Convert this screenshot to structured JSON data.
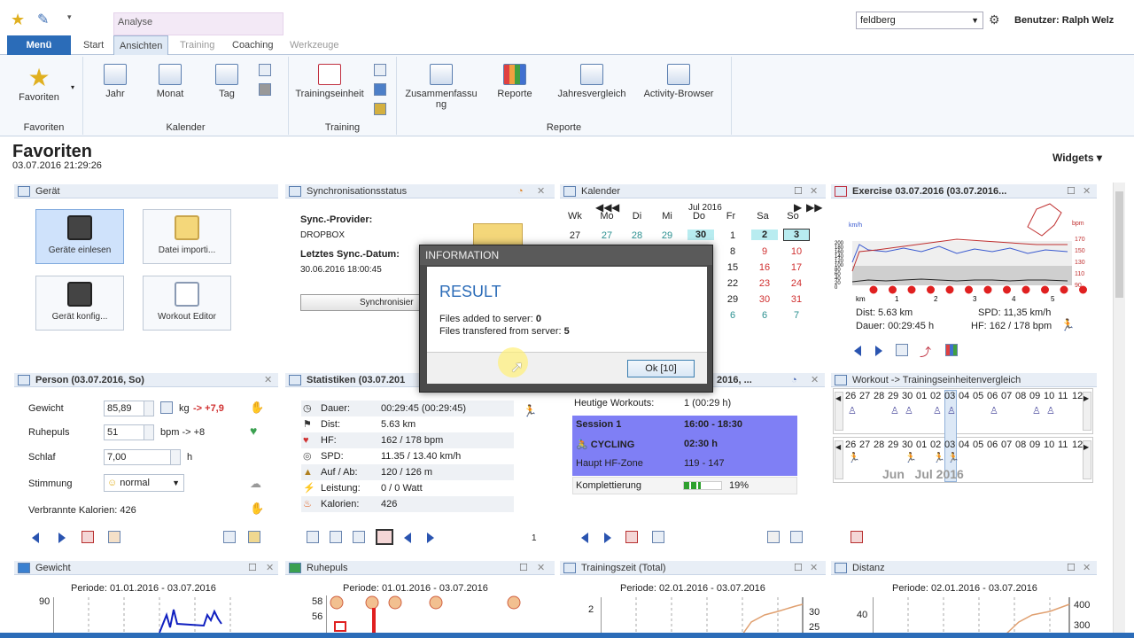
{
  "app": {
    "workspace": "feldberg",
    "user_label": "Benutzer: Ralph Welz",
    "context_tab": "Analyse"
  },
  "tabs": {
    "menu": "Menü",
    "start": "Start",
    "ansichten": "Ansichten",
    "training": "Training",
    "coaching": "Coaching",
    "werkzeuge": "Werkzeuge"
  },
  "ribbon": {
    "favoriten": "Favoriten",
    "jahr": "Jahr",
    "monat": "Monat",
    "tag": "Tag",
    "trainingseinheit": "Trainingseinheit",
    "zusammenfassung": "Zusammenfassu\nng",
    "reporte": "Reporte",
    "jahresvergleich": "Jahresvergleich",
    "activity_browser": "Activity-Browser",
    "group_favoriten": "Favoriten",
    "group_kalender": "Kalender",
    "group_training": "Training",
    "group_reporte": "Reporte"
  },
  "page": {
    "title": "Favoriten",
    "datetime": "03.07.2016 21:29:26",
    "widgets": "Widgets"
  },
  "geraet": {
    "title": "Gerät",
    "tile1": "Geräte einlesen",
    "tile2": "Datei importi...",
    "tile3": "Gerät konfig...",
    "tile4": "Workout Editor"
  },
  "sync": {
    "title": "Synchronisationsstatus",
    "provider_label": "Sync.-Provider:",
    "provider": "DROPBOX",
    "date_label": "Letztes Sync.-Datum:",
    "date": "30.06.2016 18:00:45",
    "button": "Synchronisier"
  },
  "kalender": {
    "title": "Kalender",
    "month": "Jul 2016",
    "days": [
      "Wk",
      "Mo",
      "Di",
      "Mi",
      "Do",
      "Fr",
      "Sa",
      "So"
    ],
    "row1": [
      "27",
      "27",
      "28",
      "29",
      "30",
      "1",
      "2",
      "3"
    ],
    "col_fr": [
      "8",
      "15",
      "22",
      "29",
      "6"
    ],
    "col_sa": [
      "9",
      "16",
      "23",
      "30"
    ],
    "col_so": [
      "10",
      "17",
      "24",
      "31",
      "7"
    ]
  },
  "exercise": {
    "title": "Exercise 03.07.2016 (03.07.2016...",
    "dist": "Dist: 5.63 km",
    "spd": "SPD: 11,35 km/h",
    "dauer": "Dauer: 00:29:45 h",
    "hf": "HF: 162 / 178 bpm",
    "unit_left": "km/h",
    "unit_right": "bpm",
    "y_left": [
      "200",
      "180",
      "160",
      "140",
      "120",
      "100",
      "80",
      "60",
      "40",
      "20",
      "0"
    ],
    "y_right": [
      "170",
      "150",
      "130",
      "110",
      "90"
    ],
    "x": [
      "km",
      "1",
      "2",
      "3",
      "4",
      "5"
    ]
  },
  "person": {
    "title": "Person (03.07.2016, So)",
    "gewicht_label": "Gewicht",
    "gewicht": "85,89",
    "gewicht_unit": "kg",
    "gewicht_delta": "-> +7,9",
    "ruhepuls_label": "Ruhepuls",
    "ruhepuls": "51",
    "ruhepuls_unit": "bpm -> +8",
    "schlaf_label": "Schlaf",
    "schlaf": "7,00",
    "schlaf_unit": "h",
    "stimmung_label": "Stimmung",
    "stimmung": "normal",
    "kalorien": "Verbrannte Kalorien: 426"
  },
  "statistiken": {
    "title": "Statistiken (03.07.201",
    "rows": [
      [
        "Dauer:",
        "00:29:45 (00:29:45)"
      ],
      [
        "Dist:",
        "5.63 km"
      ],
      [
        "HF:",
        "162 / 178 bpm"
      ],
      [
        "SPD:",
        "11.35 / 13.40 km/h"
      ],
      [
        "Auf / Ab:",
        "120 / 126 m"
      ],
      [
        "Leistung:",
        "0 / 0 Watt"
      ],
      [
        "Kalorien:",
        "426"
      ]
    ],
    "page": "1"
  },
  "workouts": {
    "title": "2016, ...",
    "heutige": "Heutige Workouts:",
    "heutige_val": "1 (00:29 h)",
    "session": "Session 1",
    "session_time": "16:00 - 18:30",
    "sport": "CYCLING",
    "sport_time": "02:30 h",
    "zone_label": "Haupt HF-Zone",
    "zone": "119 - 147",
    "kompl_label": "Komplettierung",
    "kompl": "19%",
    "kompl_pct": 0.19
  },
  "vergleich": {
    "title": "Workout -> Trainingseinheitenvergleich",
    "days": [
      "26",
      "27",
      "28",
      "29",
      "30",
      "01",
      "02",
      "03",
      "04",
      "05",
      "06",
      "07",
      "08",
      "09",
      "10",
      "11",
      "12"
    ],
    "months": "Jun   Jul 2016"
  },
  "bottom": {
    "gewicht": "Gewicht",
    "ruhepuls": "Ruhepuls",
    "trainingszeit": "Trainingszeit (Total)",
    "distanz": "Distanz",
    "periode1": "Periode: 01.01.2016 - 03.07.2016",
    "periode2": "Periode: 01.01.2016 - 03.07.2016",
    "periode3": "Periode: 02.01.2016 - 03.07.2016",
    "periode4": "Periode: 02.01.2016 - 03.07.2016",
    "g_y": "90",
    "r_y1": "58",
    "r_y2": "56",
    "t_y": "2",
    "t_r1": "30",
    "t_r2": "25",
    "d_y": "40",
    "d_r1": "400",
    "d_r2": "300"
  },
  "dialog": {
    "title": "INFORMATION",
    "heading": "RESULT",
    "line1_label": "Files added to server: ",
    "line1_val": "0",
    "line2_label": "Files transfered from server: ",
    "line2_val": "5",
    "ok": "Ok [10]"
  }
}
